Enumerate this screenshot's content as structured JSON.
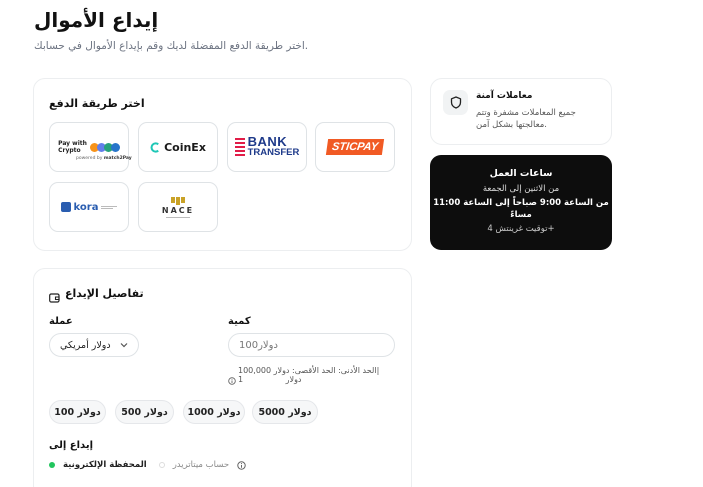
{
  "header": {
    "title": "إيداع الأموال",
    "subtitle": "اختر طريقة الدفع المفضلة لديك وقم بإيداع الأموال في حسابك."
  },
  "methods": {
    "title": "اختر طريقة الدفع",
    "items": [
      {
        "name": "Pay with Crypto",
        "line1": "Pay with",
        "line2": "Crypto",
        "sub": "powered by",
        "brand": "match2Pay"
      },
      {
        "name": "CoinEx",
        "label": "CoinEx"
      },
      {
        "name": "Bank Transfer",
        "line1": "BANK",
        "line2": "TRANSFER"
      },
      {
        "name": "STICPAY",
        "label": "STICPAY"
      },
      {
        "name": "kora",
        "label": "kora"
      },
      {
        "name": "NACE",
        "label": "NACE"
      }
    ]
  },
  "secure": {
    "title": "معاملات آمنة",
    "text_line1": "جميع المعاملات مشفرة وتتم",
    "text_line2": "معالجتها بشكل آمن."
  },
  "hours": {
    "title": "ساعات العمل",
    "days": "من الاثنين إلى الجمعة",
    "time_line1": "من الساعة 9:00 صباحاً إلى الساعة 11:00",
    "time_line2": "مساءً",
    "timezone": "توقيت غرينتش 4+"
  },
  "details": {
    "title": "تفاصيل الإيداع",
    "currency_label": "عملة",
    "currency_value": "دولار أمريكي",
    "amount_label": "كمية",
    "amount_placeholder": "100دولار",
    "limits_line1": "الحد الأدنى:",
    "limits_line1b": "الحد الأقصى: دولار",
    "limits_value": "100,000|",
    "limits_line2": "1",
    "limits_line2b": "دولار",
    "quick_amounts": [
      "دولار 100",
      "دولار 500",
      "دولار 1000",
      "دولار 5000"
    ],
    "deposit_to_label": "إيداع إلى",
    "wallet_label": "المحفظة الإلكترونية",
    "mt_label": "حساب ميتاتريدر"
  },
  "colors": {
    "accent_green": "#22c55e",
    "sticpay_orange": "#f15a24",
    "bank_blue": "#1e3a8a",
    "coinex_teal": "#1fc7b6",
    "kora_blue": "#2a5db0",
    "hours_bg": "#0d0d0d"
  }
}
